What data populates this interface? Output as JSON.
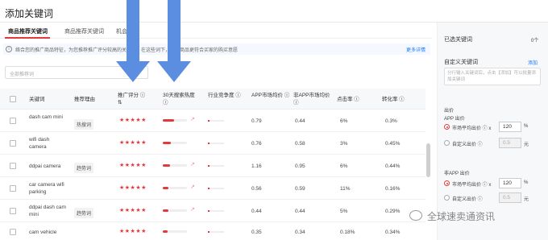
{
  "title": "添加关键词",
  "tabs": [
    {
      "label": "商品推荐关键词",
      "active": true
    },
    {
      "label": "商品推荐关键词",
      "active": false
    },
    {
      "label": "机会词",
      "active": false
    }
  ],
  "notice": {
    "text": "络合您的推广商品特征，为您推荐推广评分较高的关键词，在这些词下，您的商品更符合买家的购买意愿",
    "more": "更多详情"
  },
  "search": {
    "placeholder": "全部推荐词"
  },
  "table": {
    "headers": {
      "keyword": "关键词",
      "reason": "推荐理由",
      "score": "推广评分 ⓘ",
      "search30": "30天搜索热度 ⓘ",
      "competition": "行业竞争度 ⓘ",
      "app_price": "APP市场均价 ⓘ",
      "non_app_price": "非APP市场均价 ⓘ",
      "ctr": "点击率 ⓘ",
      "cvr": "转化率 ⓘ",
      "sort_icon": "⇅"
    },
    "rows": [
      {
        "keyword": "dash cam mini",
        "reason": "热搜词",
        "stars": "★★★★★",
        "heat": 0.45,
        "app": "0.79",
        "non_app": "0.44",
        "ctr": "6%",
        "cvr": "0.3%"
      },
      {
        "keyword": "wifi dash camera",
        "reason": "",
        "stars": "★★★★★",
        "heat": 0.35,
        "app": "0.76",
        "non_app": "0.58",
        "ctr": "3%",
        "cvr": "0.45%"
      },
      {
        "keyword": "ddpai camera",
        "reason": "趋势词",
        "stars": "★★★★★",
        "heat": 0.3,
        "app": "1.16",
        "non_app": "0.95",
        "ctr": "6%",
        "cvr": "0.44%"
      },
      {
        "keyword": "car camera wifi parking",
        "reason": "",
        "stars": "★★★★★",
        "heat": 0.25,
        "app": "0.56",
        "non_app": "0.59",
        "ctr": "11%",
        "cvr": "0.16%"
      },
      {
        "keyword": "ddpai dash cam mini",
        "reason": "趋势词",
        "stars": "★★★★★",
        "heat": 0.25,
        "app": "0.44",
        "non_app": "0.44",
        "ctr": "5%",
        "cvr": "0.29%"
      },
      {
        "keyword": "cam vehicle",
        "reason": "",
        "stars": "★★★★★",
        "heat": 0.2,
        "app": "0.35",
        "non_app": "0.34",
        "ctr": "0.18%",
        "cvr": "0.34%"
      }
    ]
  },
  "right": {
    "selected_label": "已选关键词",
    "selected_count": "0个",
    "custom_label": "自定义关键词",
    "add_link": "添加",
    "textarea_placeholder": "分行输入关键词后，点击【添加】可以批量添加关键词",
    "bid_label": "出价",
    "app_bid": "APP 出价",
    "market_avg": "市场平均出价 ⓘ x",
    "custom_bid": "自定义出价 ⓘ",
    "app_percent": "120",
    "percent_sign": "%",
    "app_custom": "0.5",
    "yuan": "元",
    "non_app_bid": "非APP 出价",
    "non_app_percent": "120",
    "non_app_custom": "0.5"
  },
  "watermark": "全球速卖通资讯",
  "colors": {
    "accent": "#e4393c",
    "link": "#1677ff",
    "arrow": "#5b8ee0"
  }
}
